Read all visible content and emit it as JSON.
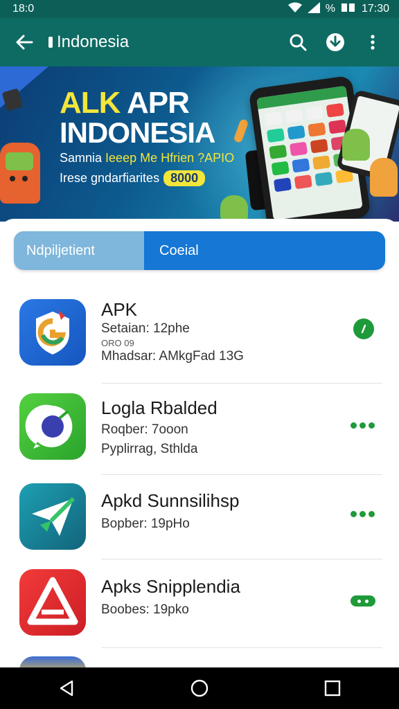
{
  "status_bar": {
    "time_left": "18:0",
    "time_right": "17:30",
    "battery_percent": "%"
  },
  "app_bar": {
    "title": "Indonesia"
  },
  "banner": {
    "headline_part1": "ALK ",
    "headline_part2": "APR",
    "headline_line2": "INDONESIA",
    "subline1_part1": "Samnia ",
    "subline1_part2": "Ieeep Me Hfrien ?APIO",
    "subline2": "Irese gndarfiarites",
    "badge": "8000"
  },
  "tabs": [
    {
      "label": "Ndpiljetient",
      "active": false
    },
    {
      "label": "Coeial",
      "active": true
    }
  ],
  "apps": [
    {
      "name": "APK",
      "line1": "Setaian: 12phe",
      "line2": "ORO 09",
      "line3": "Mhadsar: AMkgFad 13G",
      "status": "check"
    },
    {
      "name": "Logla Rbalded",
      "line1": "Roqber: 7ooon",
      "line2": "Pyplirrag, Sthlda",
      "status": "dots"
    },
    {
      "name": "Apkd Sunnsilihsp",
      "line1": "Bopber: 19pHo",
      "status": "dots"
    },
    {
      "name": "Apks Snipplendia",
      "line1": "Boobes: 19pko",
      "status": "pill"
    }
  ],
  "colors": {
    "app_bar": "#0e6b63",
    "status_bar": "#0b5f57",
    "tab_active": "#1677d4",
    "tab_inactive": "#7fb6db",
    "accent_green": "#1f9a3a",
    "banner_yellow": "#f3e63a"
  },
  "icons": [
    "back-arrow-icon",
    "search-icon",
    "download-icon",
    "more-vert-icon",
    "wifi-icon",
    "signal-icon",
    "battery-icon",
    "nav-back-icon",
    "nav-home-icon",
    "nav-recents-icon"
  ]
}
